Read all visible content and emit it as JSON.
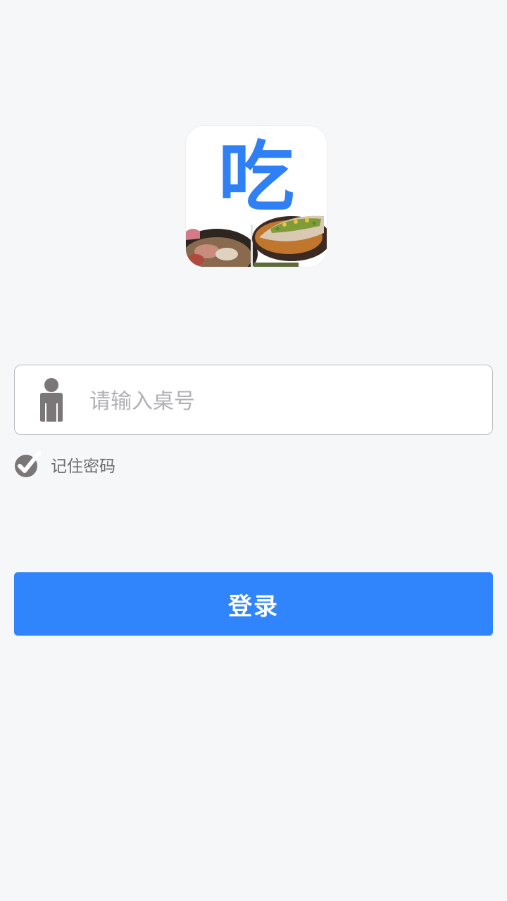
{
  "app": {
    "logo_char": "吃",
    "logo_icon": "food-dishes-icon"
  },
  "login": {
    "table_input": {
      "value": "",
      "placeholder": "请输入桌号",
      "icon": "user-icon"
    },
    "remember": {
      "label": "记住密码",
      "checked": true,
      "icon": "check-circle-icon"
    },
    "submit_label": "登录"
  },
  "colors": {
    "background": "#f5f7f9",
    "primary": "#3185fc",
    "icon_gray": "#7b7677",
    "placeholder": "#b0b1b5"
  }
}
